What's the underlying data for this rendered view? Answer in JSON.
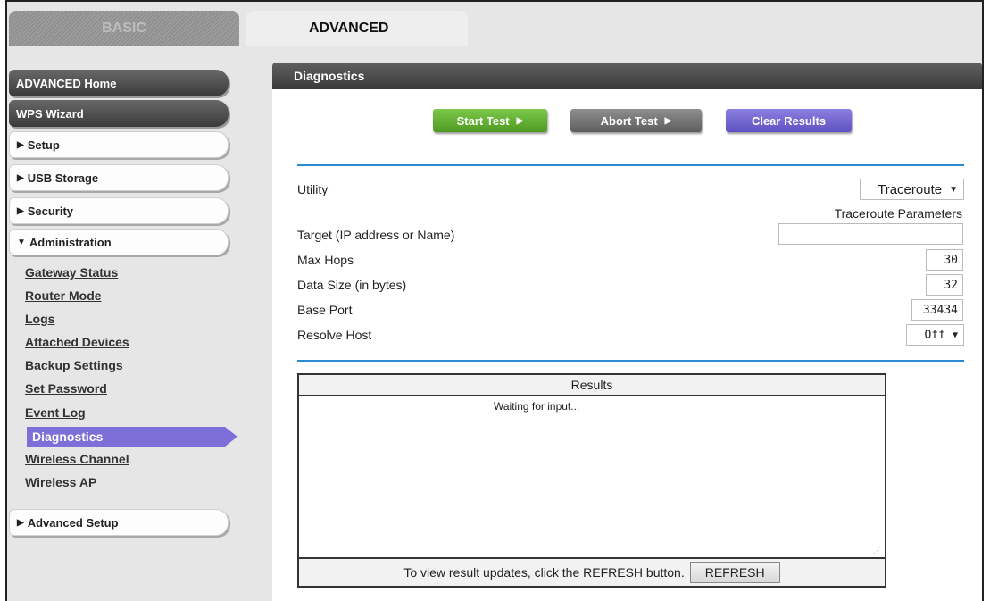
{
  "tabs": {
    "basic": "BASIC",
    "advanced": "ADVANCED"
  },
  "sidebar": {
    "advanced_home": "ADVANCED Home",
    "wps_wizard": "WPS Wizard",
    "setup": "Setup",
    "usb_storage": "USB Storage",
    "security": "Security",
    "administration": "Administration",
    "admin_items": [
      "Gateway Status",
      "Router Mode",
      "Logs",
      "Attached Devices",
      "Backup Settings",
      "Set Password",
      "Event Log"
    ],
    "active_item": "Diagnostics",
    "wireless_items": [
      "Wireless Channel",
      "Wireless AP"
    ],
    "advanced_setup": "Advanced Setup"
  },
  "panel": {
    "title": "Diagnostics",
    "start_test": "Start Test",
    "abort_test": "Abort Test",
    "clear_results": "Clear Results",
    "utility_label": "Utility",
    "utility_value": "Traceroute",
    "params_label": "Traceroute Parameters",
    "target_label": "Target (IP address or Name)",
    "target_value": "",
    "max_hops_label": "Max Hops",
    "max_hops_value": "30",
    "data_size_label": "Data Size (in bytes)",
    "data_size_value": "32",
    "base_port_label": "Base Port",
    "base_port_value": "33434",
    "resolve_host_label": "Resolve Host",
    "resolve_host_value": "Off"
  },
  "results": {
    "header": "Results",
    "body": "Waiting for input...",
    "footer_text": "To view result updates, click the REFRESH button.",
    "refresh_label": "REFRESH"
  },
  "colors": {
    "accent_blue": "#2a8bd0",
    "active_purple": "#7c6fd8",
    "start_green": "#5fae30",
    "clear_purple": "#6a5ecb"
  }
}
